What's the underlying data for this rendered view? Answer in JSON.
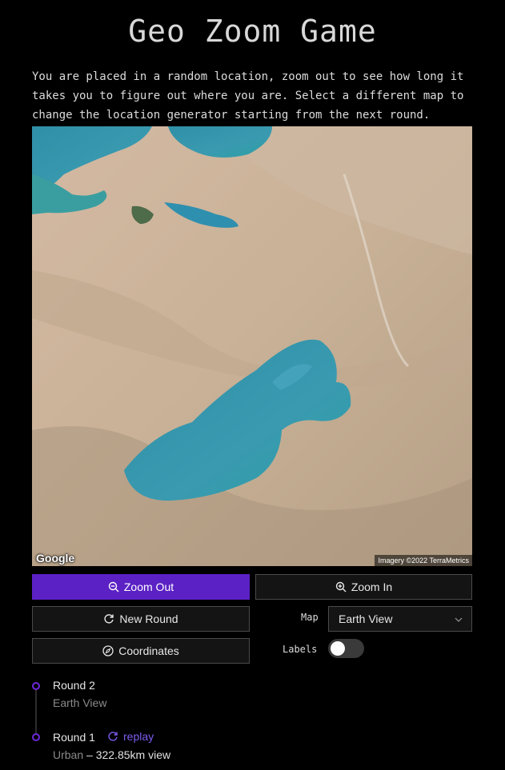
{
  "title": "Geo Zoom Game",
  "intro": "You are placed in a random location, zoom out to see how long it takes you to figure out where you are. Select a different map to change the location generator starting from the next round.",
  "map": {
    "logo": "Google",
    "attribution": "Imagery ©2022 TerraMetrics"
  },
  "controls": {
    "zoom_out_label": "Zoom Out",
    "zoom_in_label": "Zoom In",
    "new_round_label": "New Round",
    "coordinates_label": "Coordinates",
    "map_label": "Map",
    "map_selected": "Earth View",
    "labels_label": "Labels",
    "labels_on": false
  },
  "rounds": [
    {
      "title": "Round 2",
      "map": "Earth View"
    },
    {
      "title": "Round 1",
      "replay_label": "replay",
      "map": "Urban",
      "view": " – 322.85km view"
    }
  ],
  "colors": {
    "accent": "#5b21c4",
    "link": "#7c5cf0",
    "background": "#000000"
  }
}
